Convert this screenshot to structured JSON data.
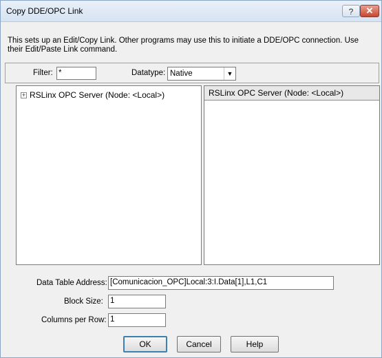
{
  "window": {
    "title": "Copy DDE/OPC Link",
    "help_glyph": "?",
    "close_glyph": "✕"
  },
  "description": "This sets up an Edit/Copy Link.  Other programs may use this to initiate a DDE/OPC connection.  Use their Edit/Paste Link command.",
  "filter": {
    "label": "Filter:",
    "value": "*",
    "datatype_label": "Datatype:",
    "datatype_value": "Native"
  },
  "tree": {
    "expander_glyph": "+",
    "root_label": "RSLinx OPC Server (Node: <Local>)"
  },
  "right_pane": {
    "header": "RSLinx OPC Server (Node: <Local>)"
  },
  "fields": {
    "address_label": "Data Table Address:",
    "address_value": "[Comunicacion_OPC]Local:3:I.Data[1],L1,C1",
    "block_size_label": "Block Size:",
    "block_size_value": "1",
    "columns_label": "Columns per Row:",
    "columns_value": "1"
  },
  "buttons": {
    "ok": "OK",
    "cancel": "Cancel",
    "help": "Help"
  }
}
